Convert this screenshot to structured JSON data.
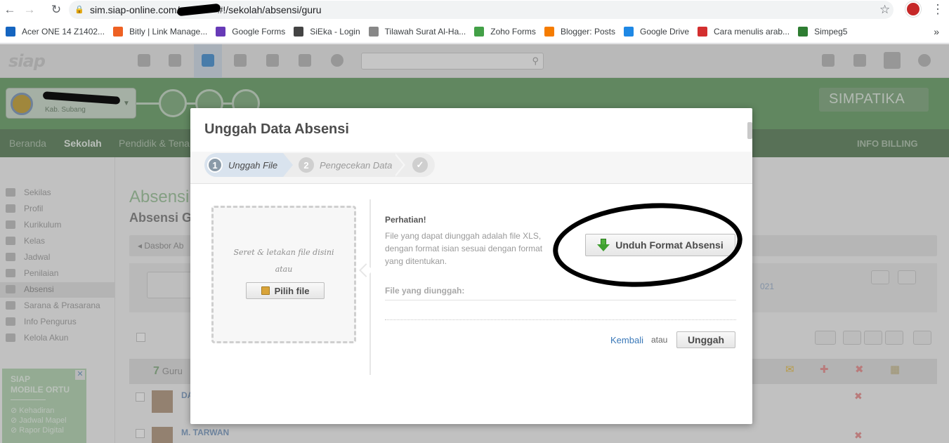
{
  "browser": {
    "url_prefix": "sim.siap-online.com/",
    "url_suffix": "#!/sekolah/absensi/guru",
    "bookmarks": [
      {
        "label": "Acer ONE 14 Z1402...",
        "color": "#1565c0"
      },
      {
        "label": "Bitly | Link Manage...",
        "color": "#ee6123"
      },
      {
        "label": "Google Forms",
        "color": "#673ab7"
      },
      {
        "label": "SiEka - Login",
        "color": "#444444"
      },
      {
        "label": "Tilawah Surat Al-Ha...",
        "color": "#888888"
      },
      {
        "label": "Zoho Forms",
        "color": "#43a047"
      },
      {
        "label": "Blogger: Posts",
        "color": "#f57c00"
      },
      {
        "label": "Google Drive",
        "color": "#1e88e5"
      },
      {
        "label": "Cara menulis arab...",
        "color": "#d32f2f"
      },
      {
        "label": "Simpeg5",
        "color": "#2e7d32"
      }
    ],
    "more": "»"
  },
  "app": {
    "logo": "siap",
    "school_sub": "Kab. Subang",
    "simpatika": "SIMPATIKA",
    "menu": {
      "beranda": "Beranda",
      "sekolah": "Sekolah",
      "pendidik": "Pendidik & Tena",
      "billing": "INFO BILLING"
    },
    "sidebar": [
      "Sekilas",
      "Profil",
      "Kurikulum",
      "Kelas",
      "Jadwal",
      "Penilaian",
      "Absensi",
      "Sarana & Prasarana",
      "Info Pengurus",
      "Kelola Akun"
    ],
    "promo": {
      "title1": "SIAP",
      "title2": "MOBILE ORTU",
      "items": [
        "⊘ Kehadiran",
        "⊘ Jadwal Mapel",
        "⊘ Rapor Digital"
      ]
    },
    "page_title": "Absensi",
    "page_subtitle": "Absensi G",
    "breadcrumb": "◂  Dasbor Ab",
    "count": "7",
    "count_unit": "Guru",
    "rows": [
      {
        "name": "DA"
      },
      {
        "name": "M. TARWAN"
      }
    ],
    "partial_number": "021"
  },
  "modal": {
    "title": "Unggah Data Absensi",
    "steps": [
      {
        "num": "1",
        "label": "Unggah File"
      },
      {
        "num": "2",
        "label": "Pengecekan Data"
      },
      {
        "num": "✓",
        "label": ""
      }
    ],
    "drop_text_1": "Seret & letakan file disini",
    "drop_text_2": "atau",
    "pick_file": "Pilih file",
    "notice_title": "Perhatian!",
    "notice_text": "File yang dapat diunggah adalah file XLS, dengan format isian sesuai dengan format yang ditentukan.",
    "download_button": "Unduh Format Absensi",
    "uploaded_label": "File yang diunggah:",
    "back": "Kembali",
    "or": "atau",
    "upload": "Unggah"
  }
}
